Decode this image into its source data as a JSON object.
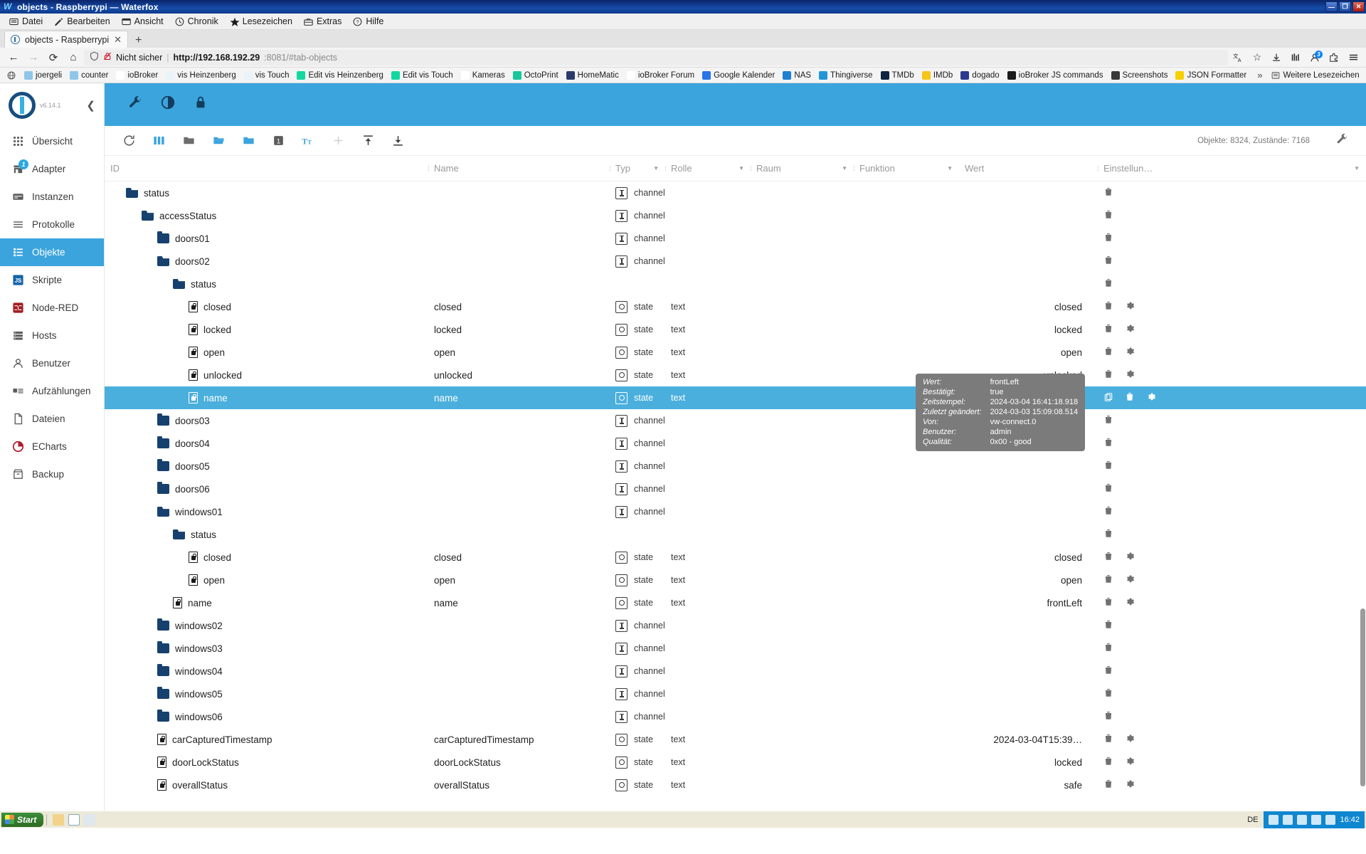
{
  "window": {
    "title": "objects - Raspberrypi — Waterfox",
    "icon": "waterfox-icon",
    "buttons": {
      "minimize": "—",
      "maximize": "❐",
      "close": "✕"
    }
  },
  "menubar": {
    "items": [
      {
        "label": "Datei",
        "icon": "file-menu-icon"
      },
      {
        "label": "Bearbeiten",
        "icon": "pencil-icon"
      },
      {
        "label": "Ansicht",
        "icon": "view-icon"
      },
      {
        "label": "Chronik",
        "icon": "clock-icon"
      },
      {
        "label": "Lesezeichen",
        "icon": "star-icon"
      },
      {
        "label": "Extras",
        "icon": "toolbox-icon"
      },
      {
        "label": "Hilfe",
        "icon": "question-circle-icon"
      }
    ]
  },
  "tabs": {
    "active": {
      "title": "objects - Raspberrypi",
      "close": "✕"
    },
    "newtab": "+"
  },
  "navbar": {
    "back": "←",
    "forward": "→",
    "reload": "⟳",
    "home": "⌂",
    "shield": "shield-icon",
    "lock_broken": "broken-lock-icon",
    "security_label": "Nicht sicher",
    "separator": "|",
    "url_host": "http://192.168.192.29",
    "url_rest": ":8081/#tab-objects",
    "translate": "translate-icon",
    "bookmark_star": "☆",
    "download": "download-icon",
    "library": "library-icon",
    "account_badge": "3",
    "extensions": "extensions-icon",
    "menu": "hamburger-menu-icon"
  },
  "bookmarks": {
    "home_icon": "globe-icon",
    "items": [
      {
        "label": "joergeli",
        "color": "#8fc6e8"
      },
      {
        "label": "counter",
        "color": "#8fc6e8"
      },
      {
        "label": "ioBroker",
        "color": "#ffffff"
      },
      {
        "label": "vis Heinzenberg",
        "color": "#e9f3fa"
      },
      {
        "label": "vis Touch",
        "color": "#e9f3fa"
      },
      {
        "label": "Edit vis Heinzenberg",
        "color": "#12d8a0"
      },
      {
        "label": "Edit vis Touch",
        "color": "#12d8a0"
      },
      {
        "label": "Kameras",
        "color": "#ffffff"
      },
      {
        "label": "OctoPrint",
        "color": "#16c79a"
      },
      {
        "label": "HomeMatic",
        "color": "#2b3a6b"
      },
      {
        "label": "ioBroker Forum",
        "color": "#ffffff"
      },
      {
        "label": "Google Kalender",
        "color": "#2a73e8"
      },
      {
        "label": "NAS",
        "color": "#1f7fd0"
      },
      {
        "label": "Thingiverse",
        "color": "#2496d6"
      },
      {
        "label": "TMDb",
        "color": "#0d253f"
      },
      {
        "label": "IMDb",
        "color": "#f5c518"
      },
      {
        "label": "dogado",
        "color": "#2b3a8f"
      },
      {
        "label": "ioBroker JS commands",
        "color": "#1b1b1b"
      },
      {
        "label": "Screenshots",
        "color": "#3a3a3a"
      },
      {
        "label": "JSON Formatter",
        "color": "#f7d000"
      }
    ],
    "overflow": "»",
    "more_label": "Weitere Lesezeichen",
    "more_icon": "bookmarks-folder-icon"
  },
  "sidebar": {
    "version": "v6.14.1",
    "collapse_icon": "chevron-left-icon",
    "items": [
      {
        "label": "Übersicht",
        "icon": "grid-icon",
        "active": false,
        "badge": ""
      },
      {
        "label": "Adapter",
        "icon": "store-icon",
        "active": false,
        "badge": "1"
      },
      {
        "label": "Instanzen",
        "icon": "instances-icon",
        "active": false,
        "badge": ""
      },
      {
        "label": "Protokolle",
        "icon": "list-icon",
        "active": false,
        "badge": ""
      },
      {
        "label": "Objekte",
        "icon": "objects-icon",
        "active": true,
        "badge": ""
      },
      {
        "label": "Skripte",
        "icon": "js-icon",
        "active": false,
        "badge": ""
      },
      {
        "label": "Node-RED",
        "icon": "node-red-icon",
        "active": false,
        "badge": ""
      },
      {
        "label": "Hosts",
        "icon": "server-icon",
        "active": false,
        "badge": ""
      },
      {
        "label": "Benutzer",
        "icon": "user-icon",
        "active": false,
        "badge": ""
      },
      {
        "label": "Aufzählungen",
        "icon": "enum-icon",
        "active": false,
        "badge": ""
      },
      {
        "label": "Dateien",
        "icon": "files-icon",
        "active": false,
        "badge": ""
      },
      {
        "label": "ECharts",
        "icon": "echarts-icon",
        "active": false,
        "badge": ""
      },
      {
        "label": "Backup",
        "icon": "backup-icon",
        "active": false,
        "badge": ""
      }
    ]
  },
  "appbar": {
    "icons": [
      "wrench-icon",
      "contrast-icon",
      "lock-icon"
    ]
  },
  "toolbar": {
    "icons": [
      "refresh-icon",
      "columns-icon",
      "folder-closed-icon",
      "folder-open-icon",
      "folder-filled-icon",
      "depth-1-icon",
      "text-size-icon",
      "add-icon",
      "import-icon",
      "export-icon"
    ],
    "depth_value": "1",
    "stats": "Objekte: 8324, Zustände: 7168",
    "settings_icon": "wrench-icon"
  },
  "table": {
    "headers": [
      {
        "label": "ID",
        "caret": ""
      },
      {
        "label": "Name",
        "caret": ""
      },
      {
        "label": "Typ",
        "caret": "▼"
      },
      {
        "label": "Rolle",
        "caret": "▼"
      },
      {
        "label": "Raum",
        "caret": "▼"
      },
      {
        "label": "Funktion",
        "caret": "▼"
      },
      {
        "label": "Wert",
        "caret": ""
      },
      {
        "label": "Einstellun…",
        "caret": "▼"
      }
    ],
    "rows": [
      {
        "id": "status",
        "indent": 1,
        "icon": "folder-open-icon",
        "name": "",
        "typ": "channel",
        "typicon": "channel-icon",
        "rolle": "",
        "wert": "",
        "delete": true,
        "gear": false,
        "copy": false,
        "selected": false
      },
      {
        "id": "accessStatus",
        "indent": 2,
        "icon": "folder-open-icon",
        "name": "",
        "typ": "channel",
        "typicon": "channel-icon",
        "rolle": "",
        "wert": "",
        "delete": true,
        "gear": false,
        "copy": false,
        "selected": false
      },
      {
        "id": "doors01",
        "indent": 3,
        "icon": "folder-closed-icon",
        "name": "",
        "typ": "channel",
        "typicon": "channel-icon",
        "rolle": "",
        "wert": "",
        "delete": true,
        "gear": false,
        "copy": false,
        "selected": false
      },
      {
        "id": "doors02",
        "indent": 3,
        "icon": "folder-open-icon",
        "name": "",
        "typ": "channel",
        "typicon": "channel-icon",
        "rolle": "",
        "wert": "",
        "delete": true,
        "gear": false,
        "copy": false,
        "selected": false
      },
      {
        "id": "status",
        "indent": 4,
        "icon": "folder-open-icon",
        "name": "",
        "typ": "",
        "typicon": "",
        "rolle": "",
        "wert": "",
        "delete": true,
        "gear": false,
        "copy": false,
        "selected": false
      },
      {
        "id": "closed",
        "indent": 5,
        "icon": "state-doc-icon",
        "name": "closed",
        "typ": "state",
        "typicon": "state-icon",
        "rolle": "text",
        "wert": "closed",
        "delete": true,
        "gear": true,
        "copy": false,
        "selected": false
      },
      {
        "id": "locked",
        "indent": 5,
        "icon": "state-doc-icon",
        "name": "locked",
        "typ": "state",
        "typicon": "state-icon",
        "rolle": "text",
        "wert": "locked",
        "delete": true,
        "gear": true,
        "copy": false,
        "selected": false
      },
      {
        "id": "open",
        "indent": 5,
        "icon": "state-doc-icon",
        "name": "open",
        "typ": "state",
        "typicon": "state-icon",
        "rolle": "text",
        "wert": "open",
        "delete": true,
        "gear": true,
        "copy": false,
        "selected": false
      },
      {
        "id": "unlocked",
        "indent": 5,
        "icon": "state-doc-icon",
        "name": "unlocked",
        "typ": "state",
        "typicon": "state-icon",
        "rolle": "text",
        "wert": "unlocked",
        "delete": true,
        "gear": true,
        "copy": false,
        "selected": false
      },
      {
        "id": "name",
        "indent": 5,
        "icon": "state-doc-icon",
        "name": "name",
        "typ": "state",
        "typicon": "state-icon",
        "rolle": "text",
        "wert": "frontLeft",
        "delete": true,
        "gear": true,
        "copy": true,
        "selected": true
      },
      {
        "id": "doors03",
        "indent": 3,
        "icon": "folder-closed-icon",
        "name": "",
        "typ": "channel",
        "typicon": "channel-icon",
        "rolle": "",
        "wert": "",
        "delete": true,
        "gear": false,
        "copy": false,
        "selected": false
      },
      {
        "id": "doors04",
        "indent": 3,
        "icon": "folder-closed-icon",
        "name": "",
        "typ": "channel",
        "typicon": "channel-icon",
        "rolle": "",
        "wert": "",
        "delete": true,
        "gear": false,
        "copy": false,
        "selected": false
      },
      {
        "id": "doors05",
        "indent": 3,
        "icon": "folder-closed-icon",
        "name": "",
        "typ": "channel",
        "typicon": "channel-icon",
        "rolle": "",
        "wert": "",
        "delete": true,
        "gear": false,
        "copy": false,
        "selected": false
      },
      {
        "id": "doors06",
        "indent": 3,
        "icon": "folder-closed-icon",
        "name": "",
        "typ": "channel",
        "typicon": "channel-icon",
        "rolle": "",
        "wert": "",
        "delete": true,
        "gear": false,
        "copy": false,
        "selected": false
      },
      {
        "id": "windows01",
        "indent": 3,
        "icon": "folder-open-icon",
        "name": "",
        "typ": "channel",
        "typicon": "channel-icon",
        "rolle": "",
        "wert": "",
        "delete": true,
        "gear": false,
        "copy": false,
        "selected": false
      },
      {
        "id": "status",
        "indent": 4,
        "icon": "folder-open-icon",
        "name": "",
        "typ": "",
        "typicon": "",
        "rolle": "",
        "wert": "",
        "delete": true,
        "gear": false,
        "copy": false,
        "selected": false
      },
      {
        "id": "closed",
        "indent": 5,
        "icon": "state-doc-icon",
        "name": "closed",
        "typ": "state",
        "typicon": "state-icon",
        "rolle": "text",
        "wert": "closed",
        "delete": true,
        "gear": true,
        "copy": false,
        "selected": false
      },
      {
        "id": "open",
        "indent": 5,
        "icon": "state-doc-icon",
        "name": "open",
        "typ": "state",
        "typicon": "state-icon",
        "rolle": "text",
        "wert": "open",
        "delete": true,
        "gear": true,
        "copy": false,
        "selected": false
      },
      {
        "id": "name",
        "indent": 4,
        "icon": "state-doc-icon",
        "name": "name",
        "typ": "state",
        "typicon": "state-icon",
        "rolle": "text",
        "wert": "frontLeft",
        "delete": true,
        "gear": true,
        "copy": false,
        "selected": false
      },
      {
        "id": "windows02",
        "indent": 3,
        "icon": "folder-closed-icon",
        "name": "",
        "typ": "channel",
        "typicon": "channel-icon",
        "rolle": "",
        "wert": "",
        "delete": true,
        "gear": false,
        "copy": false,
        "selected": false
      },
      {
        "id": "windows03",
        "indent": 3,
        "icon": "folder-closed-icon",
        "name": "",
        "typ": "channel",
        "typicon": "channel-icon",
        "rolle": "",
        "wert": "",
        "delete": true,
        "gear": false,
        "copy": false,
        "selected": false
      },
      {
        "id": "windows04",
        "indent": 3,
        "icon": "folder-closed-icon",
        "name": "",
        "typ": "channel",
        "typicon": "channel-icon",
        "rolle": "",
        "wert": "",
        "delete": true,
        "gear": false,
        "copy": false,
        "selected": false
      },
      {
        "id": "windows05",
        "indent": 3,
        "icon": "folder-closed-icon",
        "name": "",
        "typ": "channel",
        "typicon": "channel-icon",
        "rolle": "",
        "wert": "",
        "delete": true,
        "gear": false,
        "copy": false,
        "selected": false
      },
      {
        "id": "windows06",
        "indent": 3,
        "icon": "folder-closed-icon",
        "name": "",
        "typ": "channel",
        "typicon": "channel-icon",
        "rolle": "",
        "wert": "",
        "delete": true,
        "gear": false,
        "copy": false,
        "selected": false
      },
      {
        "id": "carCapturedTimestamp",
        "indent": 3,
        "icon": "state-doc-icon",
        "name": "carCapturedTimestamp",
        "typ": "state",
        "typicon": "state-icon",
        "rolle": "text",
        "wert": "2024-03-04T15:39…",
        "delete": true,
        "gear": true,
        "copy": false,
        "selected": false
      },
      {
        "id": "doorLockStatus",
        "indent": 3,
        "icon": "state-doc-icon",
        "name": "doorLockStatus",
        "typ": "state",
        "typicon": "state-icon",
        "rolle": "text",
        "wert": "locked",
        "delete": true,
        "gear": true,
        "copy": false,
        "selected": false
      },
      {
        "id": "overallStatus",
        "indent": 3,
        "icon": "state-doc-icon",
        "name": "overallStatus",
        "typ": "state",
        "typicon": "state-icon",
        "rolle": "text",
        "wert": "safe",
        "delete": true,
        "gear": true,
        "copy": false,
        "selected": false
      }
    ]
  },
  "tooltip": {
    "rows": [
      {
        "key": "Wert:",
        "value": "frontLeft"
      },
      {
        "key": "Bestätigt:",
        "value": "true"
      },
      {
        "key": "Zeitstempel:",
        "value": "2024-03-04 16:41:18.918"
      },
      {
        "key": "Zuletzt geändert:",
        "value": "2024-03-03 15:09:08.514"
      },
      {
        "key": "Von:",
        "value": "vw-connect.0"
      },
      {
        "key": "Benutzer:",
        "value": "admin"
      },
      {
        "key": "Qualität:",
        "value": "0x00 - good"
      }
    ]
  },
  "taskbar": {
    "start": "Start",
    "quick_icons": [
      "explorer-icon",
      "waterfox-icon",
      "paint-icon"
    ],
    "tray": {
      "language": "DE",
      "icons": [
        "network-icon",
        "sound-icon",
        "shield-icon",
        "updates-icon",
        "usb-icon"
      ],
      "time": "16:42"
    }
  },
  "colors": {
    "accent": "#3ba4dd",
    "selected_row": "#4aafdd",
    "folder": "#16416e",
    "titlebar": "#0a246a"
  }
}
